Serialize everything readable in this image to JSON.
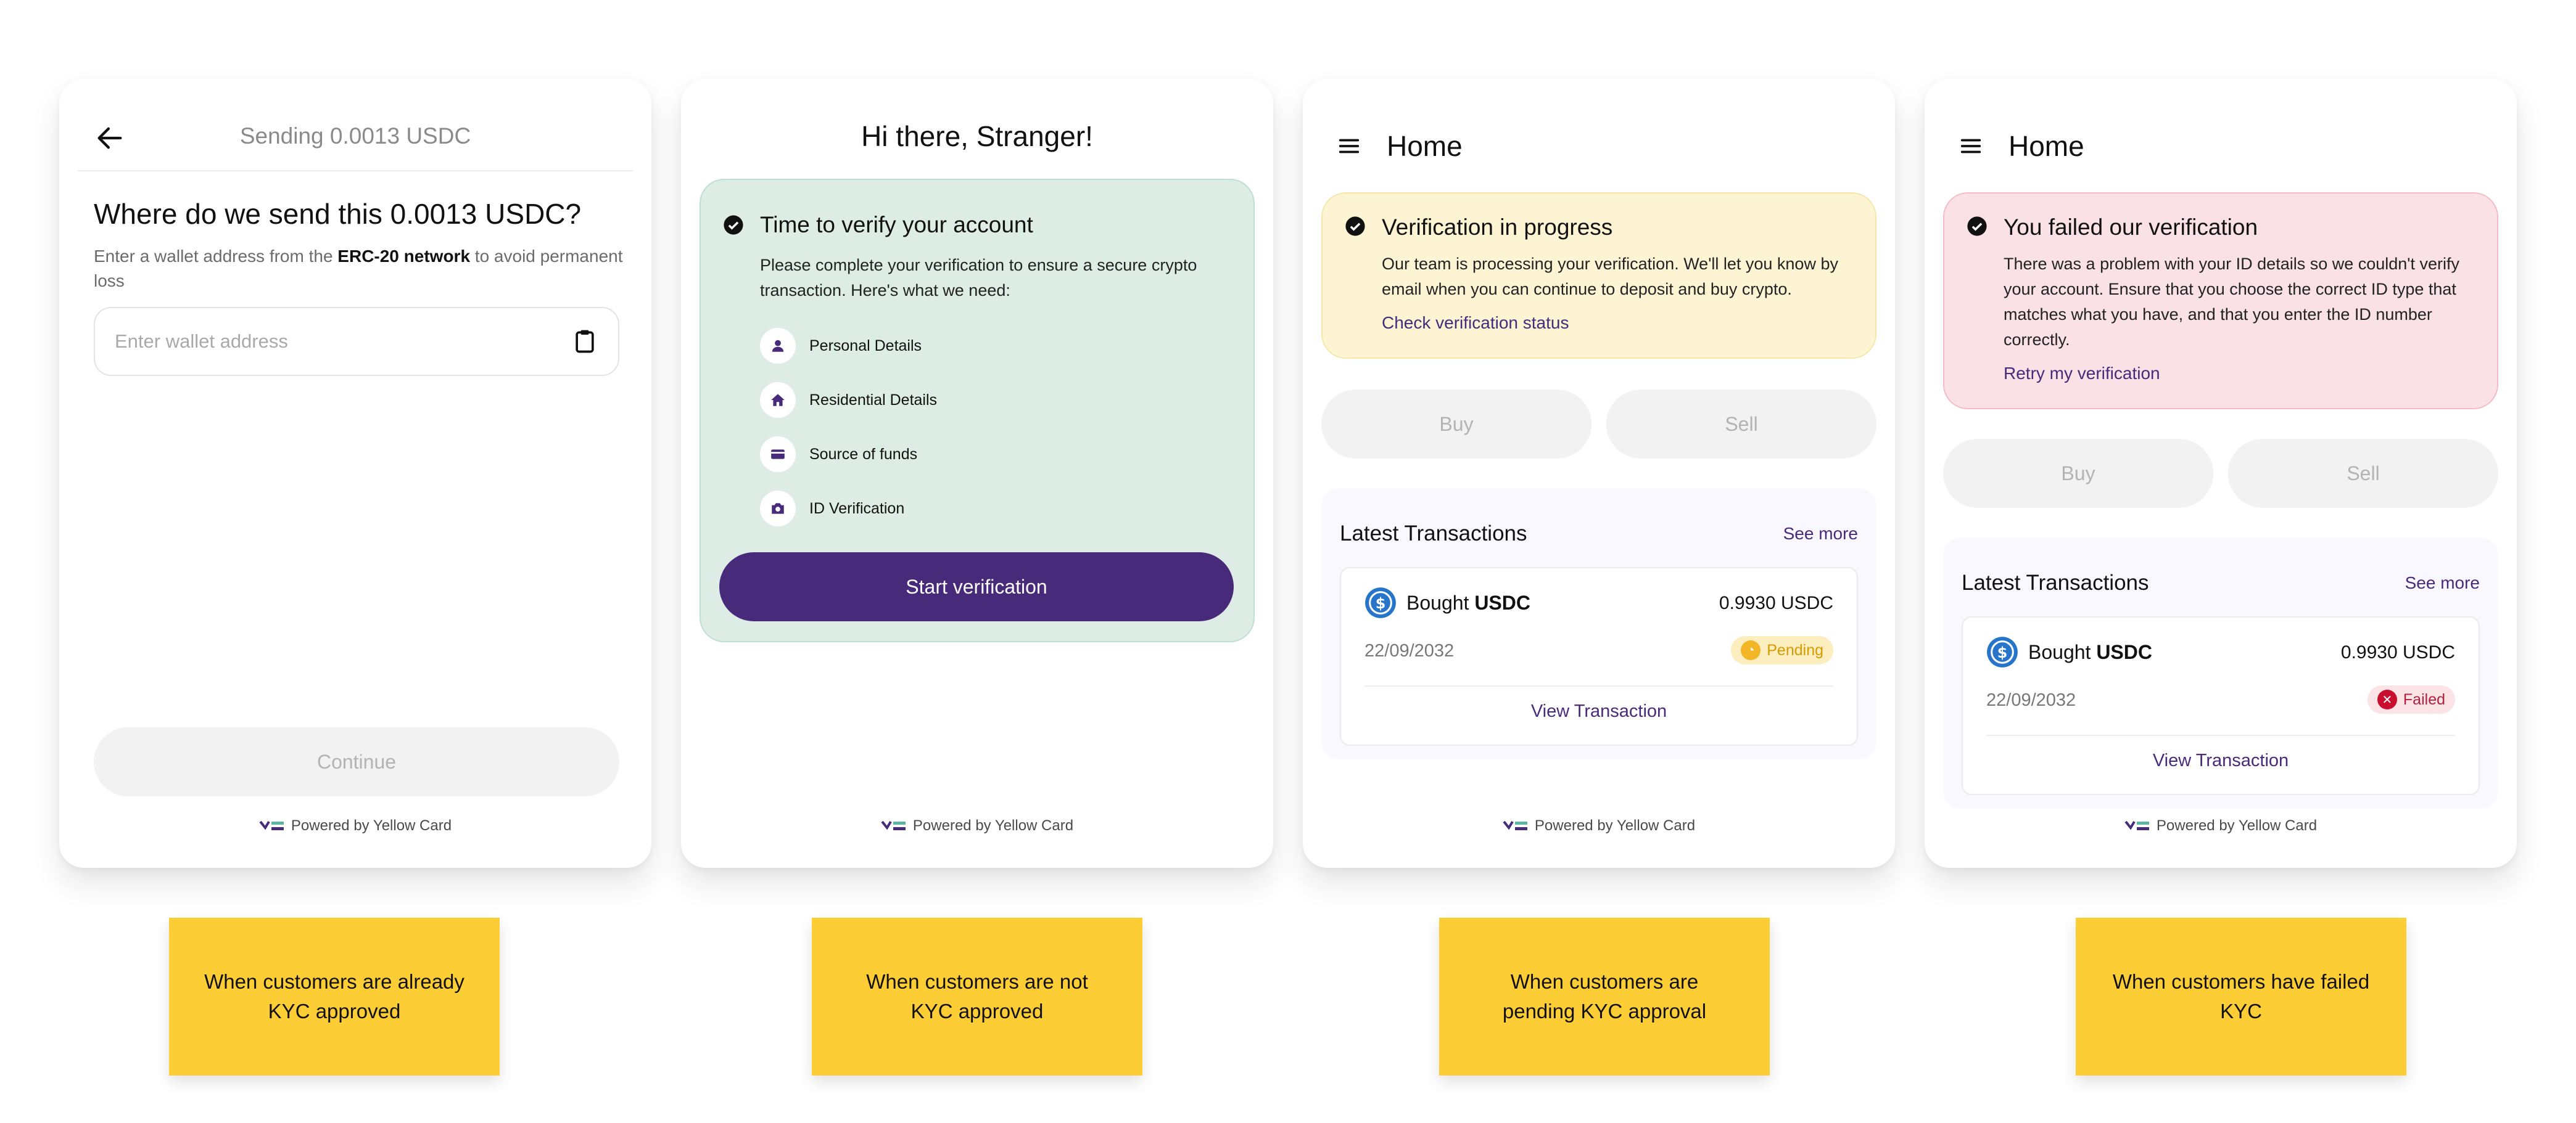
{
  "colors": {
    "brand_purple": "#482a7b",
    "sticky_yellow": "#fdcd35",
    "verify_green": "#ddece5",
    "pending_yellow": "#fdf4d4",
    "failed_pink": "#f9e1e6",
    "usdc_blue": "#2775ca"
  },
  "footer_text": "Powered by Yellow Card",
  "card1": {
    "header_title": "Sending 0.0013 USDC",
    "question": "Where do we send this 0.0013 USDC?",
    "help_prefix": "Enter a wallet address from the ",
    "help_bold": "ERC-20 network",
    "help_suffix": " to avoid permanent loss",
    "wallet_placeholder": "Enter wallet address",
    "continue_label": "Continue"
  },
  "card2": {
    "greeting": "Hi there, Stranger!",
    "panel_title": "Time to verify your account",
    "panel_body": "Please complete your verification to ensure a secure crypto transaction. Here's what we need:",
    "requirements": [
      {
        "label": "Personal Details",
        "icon": "person-icon"
      },
      {
        "label": "Residential Details",
        "icon": "home-icon"
      },
      {
        "label": "Source of funds",
        "icon": "card-icon"
      },
      {
        "label": "ID Verification",
        "icon": "camera-icon"
      }
    ],
    "start_label": "Start verification"
  },
  "card3": {
    "title": "Home",
    "status_title": "Verification in progress",
    "status_body": "Our team is processing your verification. We'll let you know by email when you can continue to deposit and buy crypto.",
    "status_link": "Check verification status",
    "buy_label": "Buy",
    "sell_label": "Sell",
    "tx_heading": "Latest Transactions",
    "see_more": "See more",
    "tx": {
      "prefix": "Bought ",
      "asset": "USDC",
      "amount": "0.9930 USDC",
      "date": "22/09/2032",
      "status": "Pending"
    },
    "view_tx": "View Transaction"
  },
  "card4": {
    "title": "Home",
    "status_title": "You failed our verification",
    "status_body": "There was a problem with your ID details so we couldn't verify your account. Ensure that you choose the correct ID type that matches what you have, and that you enter the ID number correctly.",
    "status_link": "Retry my verification",
    "buy_label": "Buy",
    "sell_label": "Sell",
    "tx_heading": "Latest Transactions",
    "see_more": "See more",
    "tx": {
      "prefix": "Bought ",
      "asset": "USDC",
      "amount": "0.9930 USDC",
      "date": "22/09/2032",
      "status": "Failed"
    },
    "view_tx": "View Transaction"
  },
  "notes": [
    "When customers are already\nKYC approved",
    "When customers are not\nKYC approved",
    "When customers are\npending KYC approval",
    "When customers have failed\nKYC"
  ]
}
